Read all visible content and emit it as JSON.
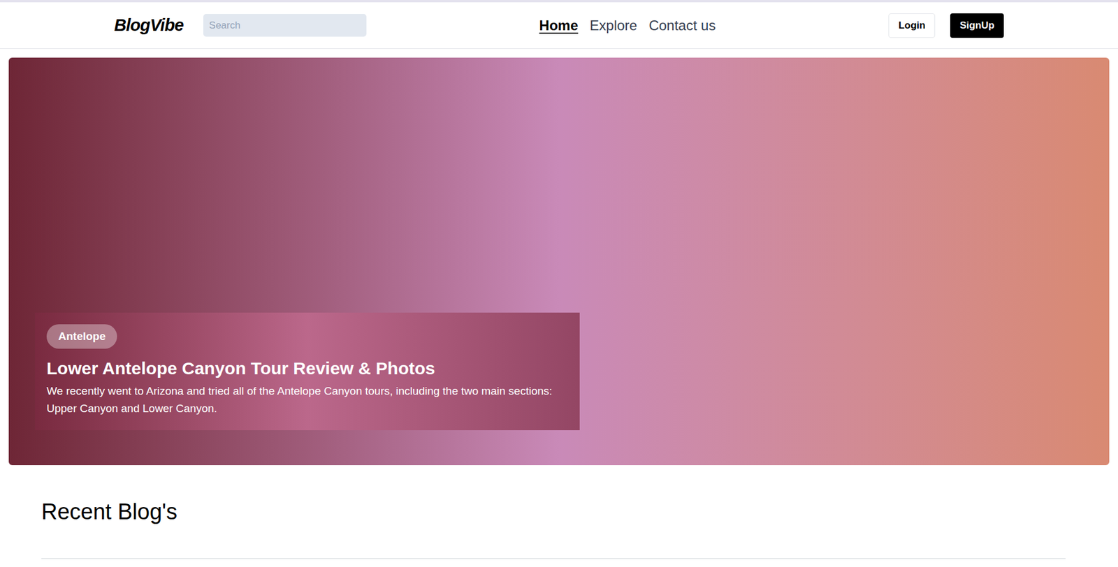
{
  "header": {
    "logo": "BlogVibe",
    "search": {
      "placeholder": "Search"
    },
    "nav": [
      {
        "label": "Home",
        "selected": true
      },
      {
        "label": "Explore",
        "selected": false
      },
      {
        "label": "Contact us",
        "selected": false
      }
    ],
    "buttons": {
      "login": "Login",
      "signup": "SignUp"
    }
  },
  "hero": {
    "tag": "Antelope",
    "title": "Lower Antelope Canyon Tour Review & Photos",
    "description": "We recently went to Arizona and tried all of the Antelope Canyon tours, including the two main sections: Upper Canyon and Lower Canyon."
  },
  "recent": {
    "title": "Recent Blog's"
  }
}
